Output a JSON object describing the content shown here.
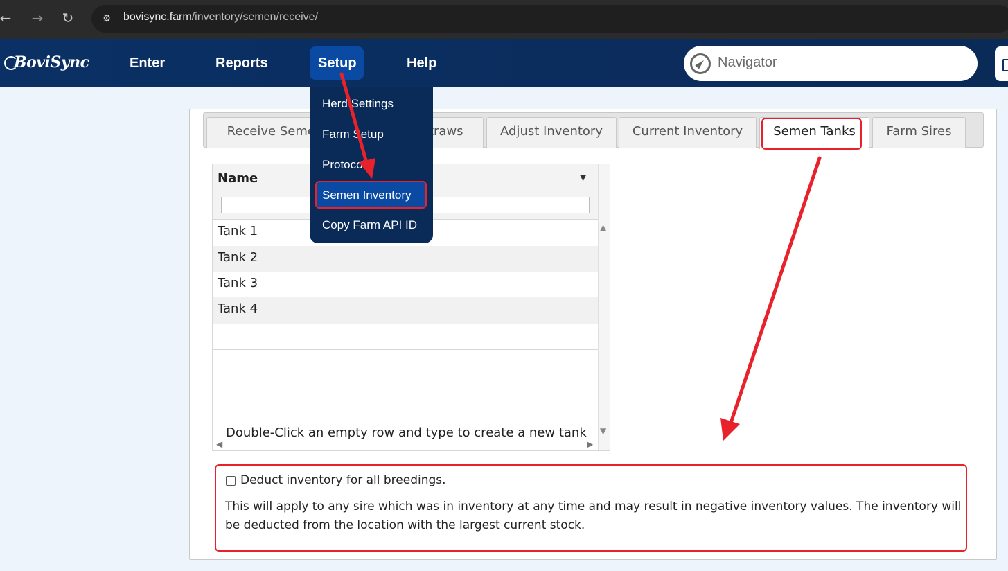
{
  "browser": {
    "url_domain": "bovisync.farm",
    "url_path": "/inventory/semen/receive/",
    "icons": [
      "back-arrow-icon",
      "forward-arrow-icon",
      "reload-icon",
      "site-info-icon"
    ]
  },
  "header": {
    "logo_text": "BoviSync",
    "menu": [
      "Enter",
      "Reports",
      "Setup",
      "Help"
    ],
    "active_menu": "Setup",
    "navigator_placeholder": "Navigator"
  },
  "setup_menu": {
    "items": [
      "Herd Settings",
      "Farm Setup",
      "Protocols",
      "Semen Inventory",
      "Copy Farm API ID"
    ],
    "highlighted": "Semen Inventory"
  },
  "tabs": {
    "items": [
      "Receive Semen",
      "Transfer Straws",
      "Adjust Inventory",
      "Current Inventory",
      "Semen Tanks",
      "Farm Sires"
    ],
    "active": "Semen Tanks"
  },
  "grid": {
    "column": "Name",
    "rows": [
      "Tank 1",
      "Tank 2",
      "Tank 3",
      "Tank 4"
    ],
    "footer": "Double-Click an empty row and type to create a new tank"
  },
  "deduct": {
    "checkbox_label": "Deduct inventory for all breedings.",
    "checked": false,
    "description": "This will apply to any sire which was in inventory at any time and may result in negative inventory values. The inventory will be deducted from the location with the largest current stock."
  },
  "colors": {
    "header_navy": "#0a3065",
    "accent_blue": "#0b4aa2",
    "annotation_red": "#e8222a",
    "page_bg": "#eef4fb"
  }
}
